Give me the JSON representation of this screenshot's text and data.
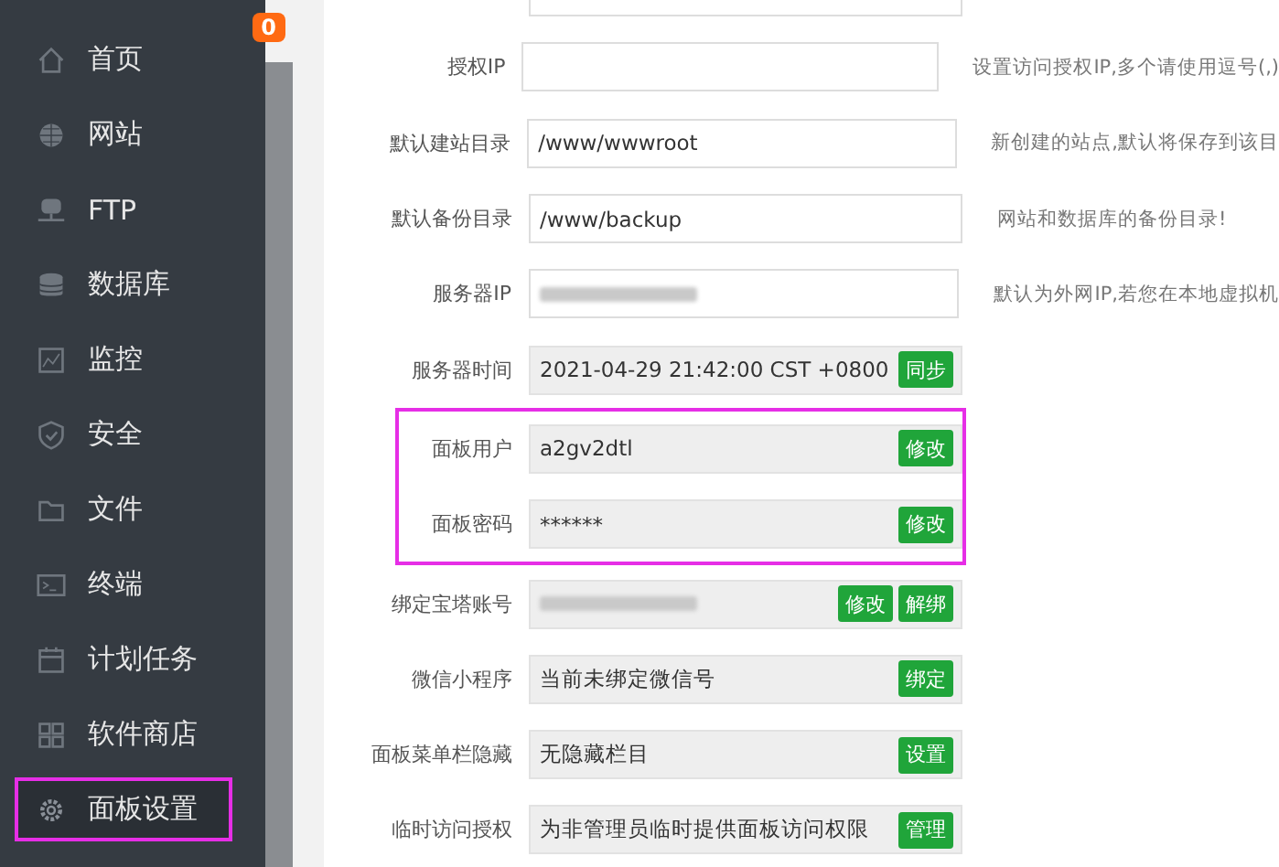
{
  "sidebar": {
    "badge": "0",
    "items": [
      {
        "label": "首页",
        "selected": false,
        "highlighted": false
      },
      {
        "label": "网站",
        "selected": false,
        "highlighted": false
      },
      {
        "label": "FTP",
        "selected": false,
        "highlighted": false
      },
      {
        "label": "数据库",
        "selected": false,
        "highlighted": false
      },
      {
        "label": "监控",
        "selected": false,
        "highlighted": false
      },
      {
        "label": "安全",
        "selected": false,
        "highlighted": false
      },
      {
        "label": "文件",
        "selected": false,
        "highlighted": false
      },
      {
        "label": "终端",
        "selected": false,
        "highlighted": false
      },
      {
        "label": "计划任务",
        "selected": false,
        "highlighted": false
      },
      {
        "label": "软件商店",
        "selected": false,
        "highlighted": false
      },
      {
        "label": "面板设置",
        "selected": true,
        "highlighted": true
      }
    ]
  },
  "settings": [
    {
      "kind": "input",
      "highlighted": false
    },
    {
      "kind": "input",
      "label": "授权IP",
      "hint": "设置访问授权IP,多个请使用逗号(,)",
      "highlighted": false
    },
    {
      "kind": "input",
      "label": "默认建站目录",
      "value": "/www/wwwroot",
      "hint": "新创建的站点,默认将保存到该目",
      "highlighted": false
    },
    {
      "kind": "input",
      "label": "默认备份目录",
      "value": "/www/backup",
      "hint": "网站和数据库的备份目录!",
      "highlighted": false
    },
    {
      "kind": "input",
      "label": "服务器IP",
      "redacted": true,
      "hint": "默认为外网IP,若您在本地虚拟机",
      "highlighted": false
    },
    {
      "kind": "readonly",
      "label": "服务器时间",
      "value": "2021-04-29 21:42:00 CST +0800",
      "buttons": [
        "同步"
      ],
      "highlighted": false
    },
    {
      "kind": "readonly",
      "label": "面板用户",
      "value": "a2gv2dtl",
      "buttons": [
        "修改"
      ],
      "highlighted": true
    },
    {
      "kind": "readonly",
      "label": "面板密码",
      "value": "******",
      "buttons": [
        "修改"
      ],
      "highlighted": true
    },
    {
      "kind": "readonly",
      "label": "绑定宝塔账号",
      "redacted": true,
      "buttons": [
        "修改",
        "解绑"
      ],
      "highlighted": false
    },
    {
      "kind": "readonly",
      "label": "微信小程序",
      "value": "当前未绑定微信号",
      "buttons": [
        "绑定"
      ],
      "highlighted": false
    },
    {
      "kind": "readonly",
      "label": "面板菜单栏隐藏",
      "value": "无隐藏栏目",
      "buttons": [
        "设置"
      ],
      "highlighted": false
    },
    {
      "kind": "readonly",
      "label": "临时访问授权",
      "value": "为非管理员临时提供面板访问权限",
      "buttons": [
        "管理"
      ],
      "highlighted": false
    }
  ]
}
